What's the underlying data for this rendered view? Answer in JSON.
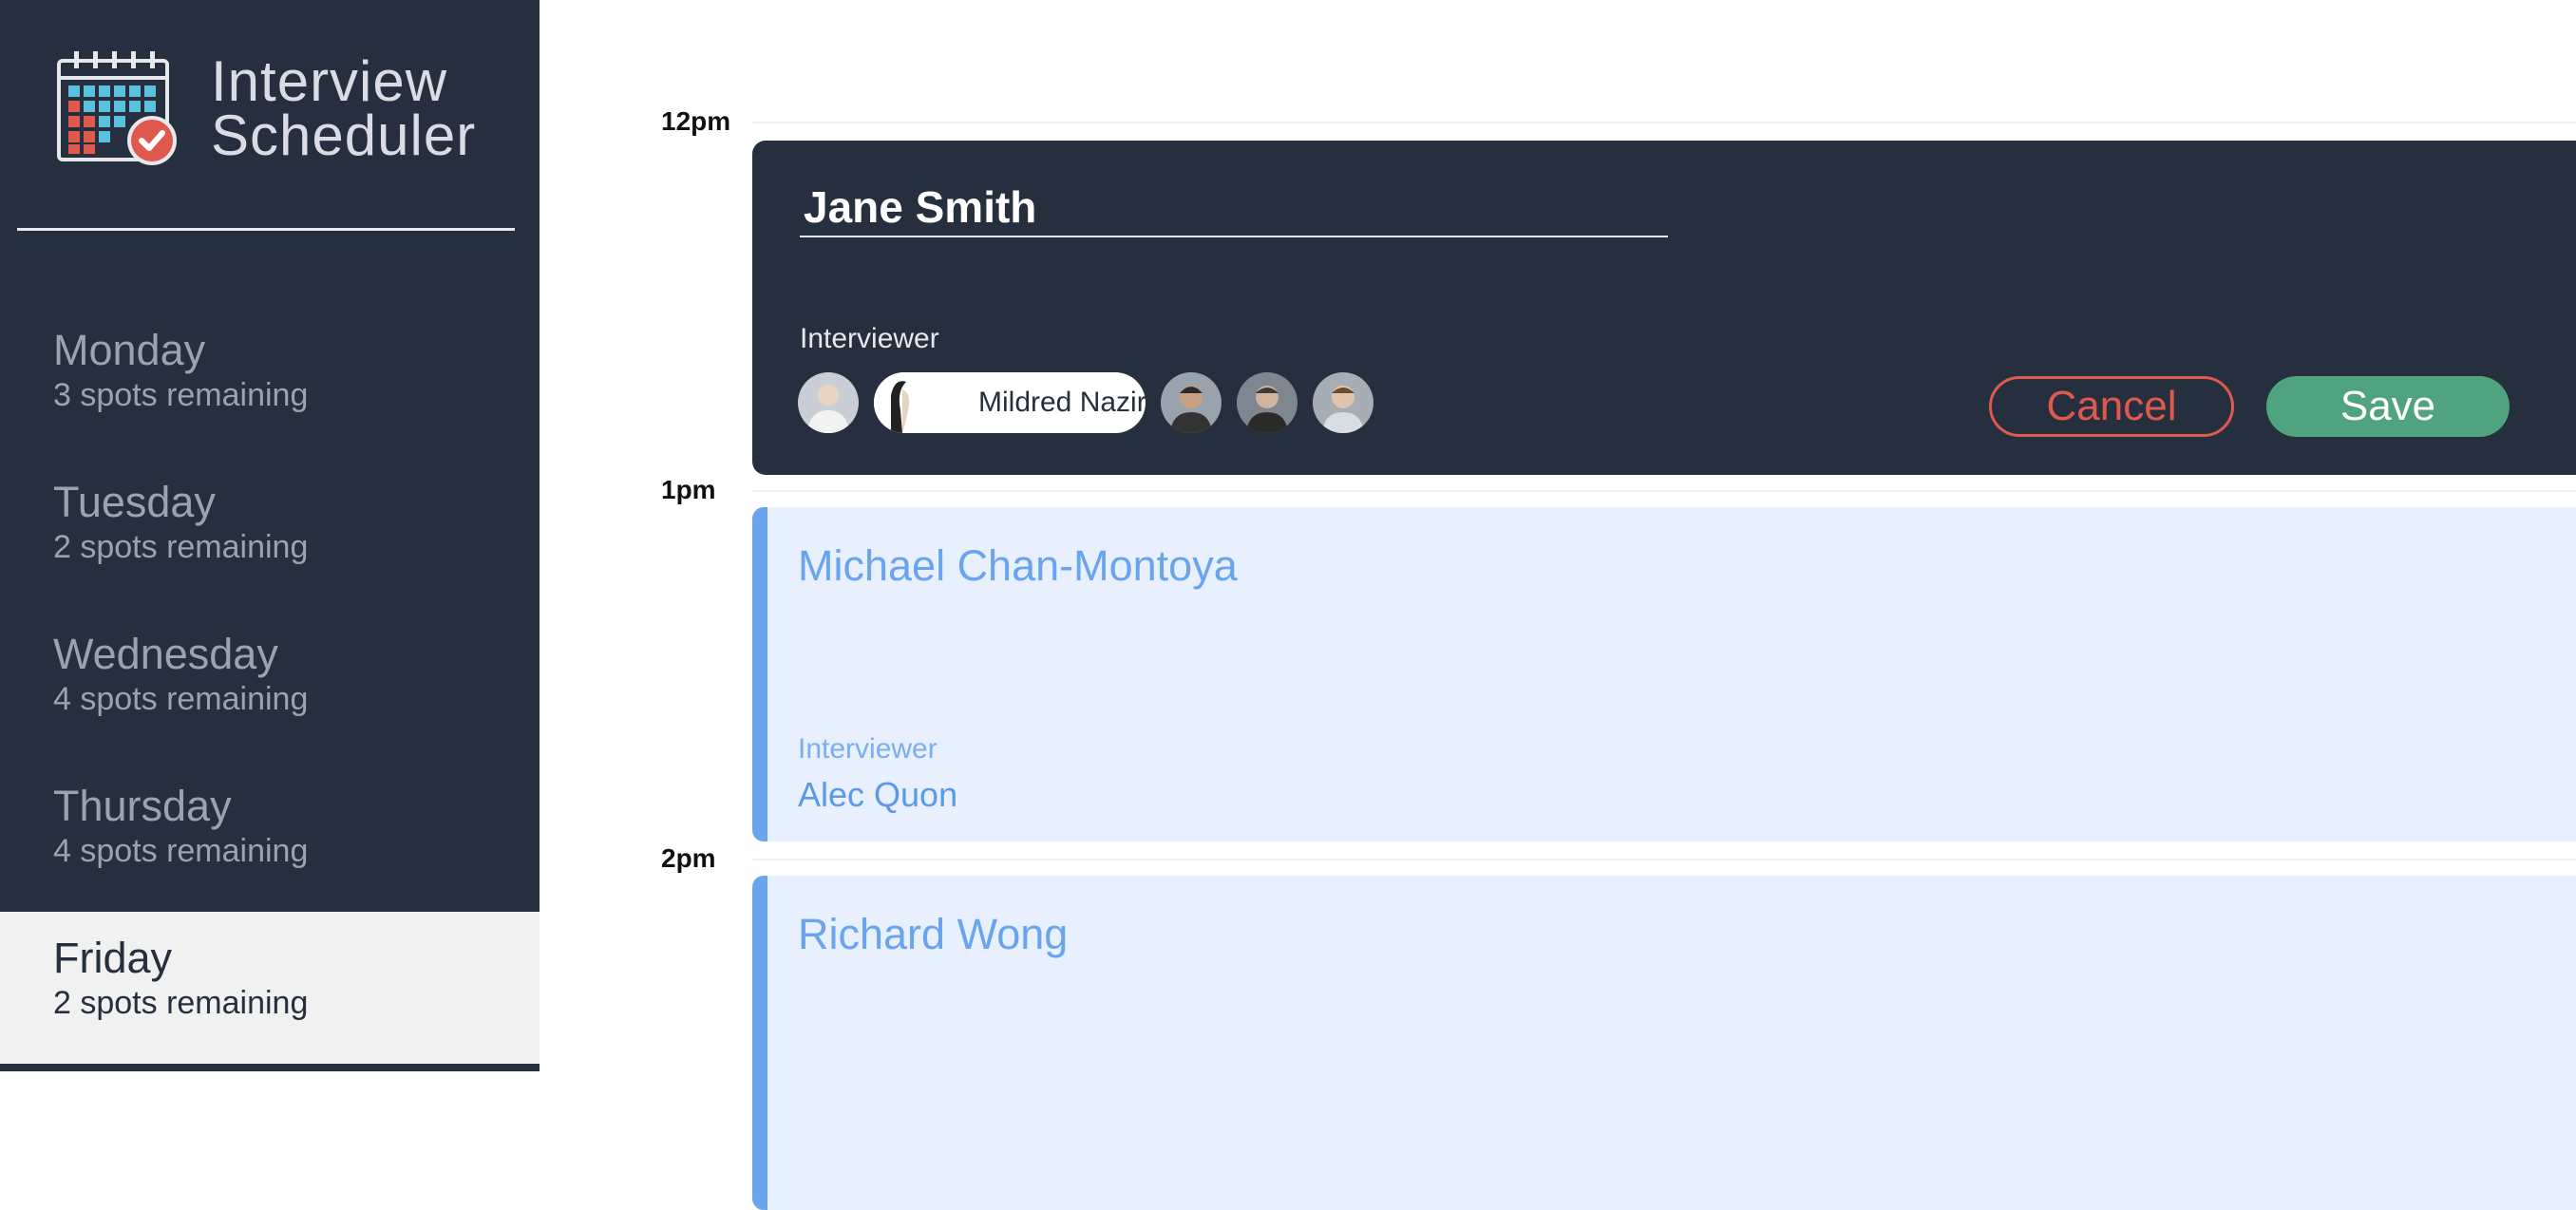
{
  "app": {
    "title_line1": "Interview",
    "title_line2": "Scheduler",
    "logo_icon": "calendar-check-icon"
  },
  "days": [
    {
      "name": "Monday",
      "spots": "3 spots remaining",
      "selected": false
    },
    {
      "name": "Tuesday",
      "spots": "2 spots remaining",
      "selected": false
    },
    {
      "name": "Wednesday",
      "spots": "4 spots remaining",
      "selected": false
    },
    {
      "name": "Thursday",
      "spots": "4 spots remaining",
      "selected": false
    },
    {
      "name": "Friday",
      "spots": "2 spots remaining",
      "selected": true
    }
  ],
  "schedule": {
    "times": [
      "12pm",
      "1pm",
      "2pm"
    ],
    "form": {
      "student_name": "Jane Smith",
      "interviewer_label": "Interviewer",
      "selected_interviewer": "Mildred Nazir",
      "interviewer_avatars": [
        "avatar-1",
        "avatar-selected",
        "avatar-3",
        "avatar-4",
        "avatar-5"
      ],
      "cancel_label": "Cancel",
      "save_label": "Save"
    },
    "appointments": [
      {
        "student": "Michael Chan-Montoya",
        "interviewer_label": "Interviewer",
        "interviewer": "Alec Quon"
      },
      {
        "student": "Richard Wong"
      }
    ]
  },
  "colors": {
    "sidebar_bg": "#252f3e",
    "selected_day_bg": "#f1f1f1",
    "appointment_bg": "#e7f0fc",
    "appointment_accent": "#6aa4ef",
    "cancel": "#e0594f",
    "save": "#4fa37e"
  }
}
